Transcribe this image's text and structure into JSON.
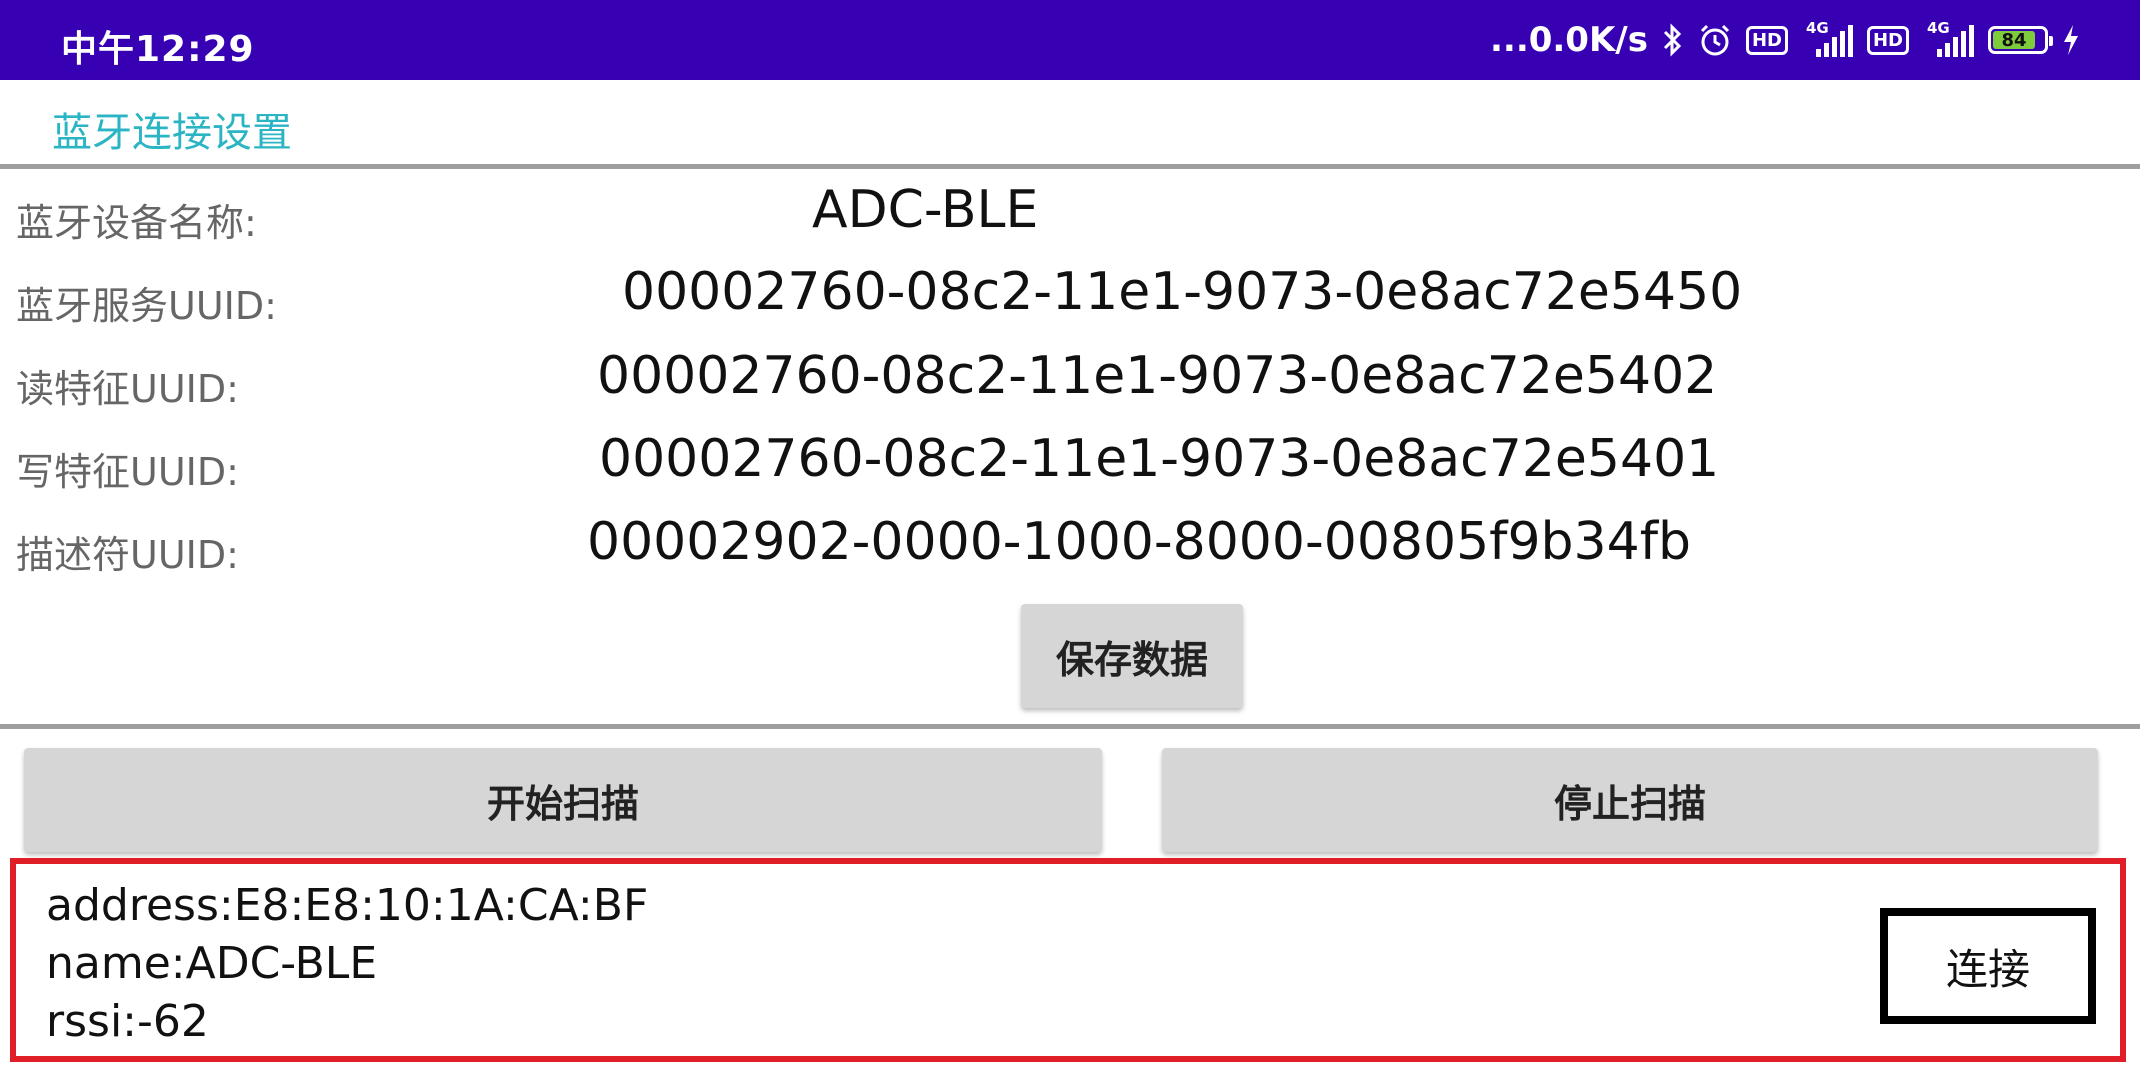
{
  "status_bar": {
    "time": "中午12:29",
    "network_speed": "...0.0K/s",
    "icons": [
      "bluetooth-icon",
      "alarm-icon",
      "hd-icon",
      "signal-4g-icon",
      "hd-icon",
      "signal-4g-icon",
      "battery-icon",
      "charging-icon"
    ],
    "hd_label": "HD",
    "net_label": "4G",
    "battery_level": "84",
    "battery_color": "#7ecb3c"
  },
  "app": {
    "title": "蓝牙连接设置",
    "accent_color": "#2bb5c4",
    "bar_color": "#3700b3"
  },
  "settings": {
    "device_name_label": "蓝牙设备名称:",
    "device_name_value": "ADC-BLE",
    "service_uuid_label": "蓝牙服务UUID:",
    "service_uuid_value": "00002760-08c2-11e1-9073-0e8ac72e5450",
    "read_uuid_label": "读特征UUID:",
    "read_uuid_value": "00002760-08c2-11e1-9073-0e8ac72e5402",
    "write_uuid_label": "写特征UUID:",
    "write_uuid_value": "00002760-08c2-11e1-9073-0e8ac72e5401",
    "descriptor_uuid_label": "描述符UUID:",
    "descriptor_uuid_value": "00002902-0000-1000-8000-00805f9b34fb",
    "save_button": "保存数据"
  },
  "scan": {
    "start_button": "开始扫描",
    "stop_button": "停止扫描"
  },
  "devices": [
    {
      "address": "address:E8:E8:10:1A:CA:BF",
      "name": "name:ADC-BLE",
      "rssi": "rssi:-62",
      "connect_label": "连接"
    }
  ]
}
